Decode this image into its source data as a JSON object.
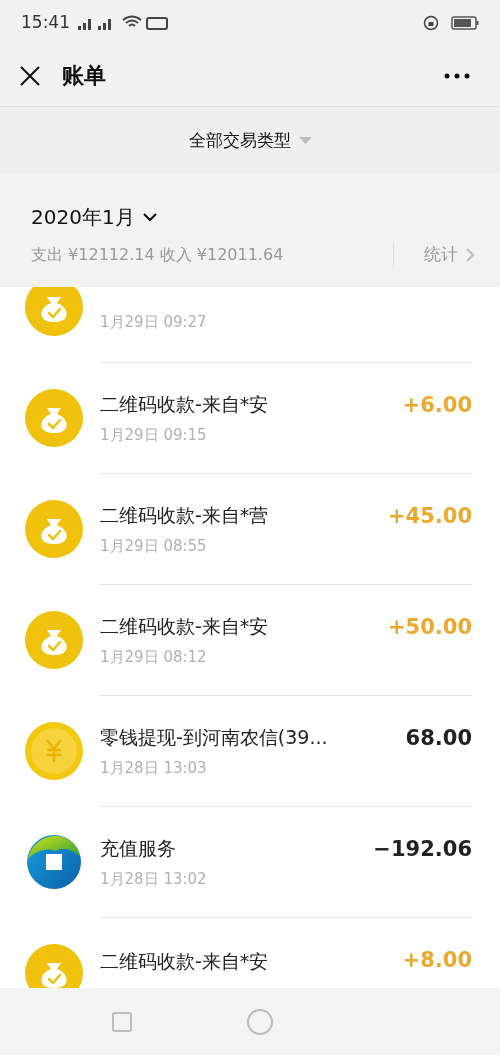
{
  "status_bar": {
    "time": "15:41"
  },
  "header": {
    "title": "账单"
  },
  "filter": {
    "label": "全部交易类型"
  },
  "month": {
    "label": "2020年1月",
    "summary": "支出 ¥12112.14 收入 ¥12011.64",
    "stats_link": "统计"
  },
  "transactions": [
    {
      "kind": "qr",
      "date": "1月29日 09:27"
    },
    {
      "kind": "qr",
      "title": "二维码收款-来自*安",
      "date": "1月29日 09:15",
      "amount": "+6.00",
      "income": true
    },
    {
      "kind": "qr",
      "title": "二维码收款-来自*营",
      "date": "1月29日 08:55",
      "amount": "+45.00",
      "income": true
    },
    {
      "kind": "qr",
      "title": "二维码收款-来自*安",
      "date": "1月29日 08:12",
      "amount": "+50.00",
      "income": true
    },
    {
      "kind": "coin",
      "title": "零钱提现-到河南农信(39...",
      "date": "1月28日 13:03",
      "amount": "68.00",
      "income": false
    },
    {
      "kind": "recharge",
      "title": "充值服务",
      "date": "1月28日 13:02",
      "amount": "−192.06",
      "income": false
    },
    {
      "kind": "qr",
      "title": "二维码收款-来自*安",
      "amount": "+8.00",
      "income": true
    }
  ]
}
